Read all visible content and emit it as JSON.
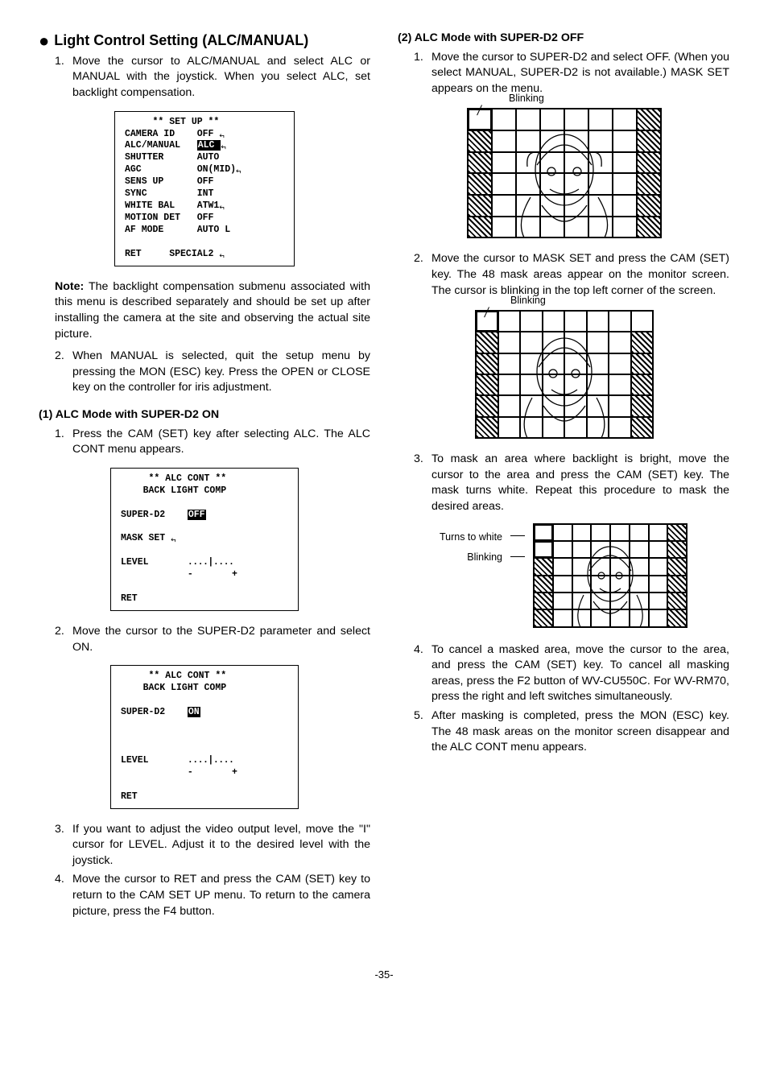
{
  "leftCol": {
    "heading": "Light Control Setting (ALC/MANUAL)",
    "step1": "Move the cursor to ALC/MANUAL and select ALC or MANUAL with the joystick. When you select ALC, set backlight compensation.",
    "osd1": {
      "title": "** SET UP **",
      "rows": [
        [
          "CAMERA ID",
          "OFF ",
          true
        ],
        [
          "ALC/MANUAL",
          "ALC ",
          true,
          true
        ],
        [
          "SHUTTER",
          "AUTO",
          false
        ],
        [
          "AGC",
          "ON(MID)",
          true
        ],
        [
          "SENS UP",
          "OFF",
          false
        ],
        [
          "SYNC",
          "INT",
          false
        ],
        [
          "WHITE BAL",
          "ATW1",
          true
        ],
        [
          "MOTION DET",
          "OFF",
          false
        ],
        [
          "AF MODE",
          "AUTO L",
          false
        ]
      ],
      "footer": [
        "RET",
        "SPECIAL2 "
      ]
    },
    "noteLabel": "Note:",
    "noteText": "The backlight compensation submenu associated with this menu is described separately and should be set up after installing the camera at the site and observing the actual site picture.",
    "step2": "When MANUAL is selected, quit the setup menu by pressing the MON (ESC) key. Press the OPEN or CLOSE key on the controller for iris adjustment.",
    "sub1": "(1) ALC Mode with SUPER-D2 ON",
    "sub1_step1": "Press the CAM (SET) key after selecting ALC. The ALC CONT menu appears.",
    "osd2": {
      "title1": "** ALC CONT **",
      "title2": "BACK LIGHT COMP",
      "sd2Label": "SUPER-D2",
      "sd2Val": "OFF",
      "sd2Hl": true,
      "mask": "MASK SET ",
      "maskArrow": true,
      "levelLabel": "LEVEL",
      "levelSlider": "....|....",
      "levelMinus": "-",
      "levelPlus": "+",
      "ret": "RET"
    },
    "sub1_step2": "Move the cursor to the SUPER-D2 parameter and select ON.",
    "osd3": {
      "title1": "** ALC CONT **",
      "title2": "BACK LIGHT COMP",
      "sd2Label": "SUPER-D2",
      "sd2Val": "ON",
      "sd2Hl": true,
      "levelLabel": "LEVEL",
      "levelSlider": "....|....",
      "levelMinus": "-",
      "levelPlus": "+",
      "ret": "RET"
    },
    "sub1_step3": "If you want to adjust the video output level, move the \"I\" cursor for LEVEL. Adjust it to the desired level with the joystick.",
    "sub1_step4": "Move the cursor to RET and press the CAM (SET) key to return to the CAM SET UP menu. To return to the camera picture, press the F4 button."
  },
  "rightCol": {
    "sub2": "(2) ALC Mode with SUPER-D2 OFF",
    "sub2_step1": "Move the cursor to SUPER-D2 and select OFF. (When you select MANUAL, SUPER-D2 is not available.) MASK SET appears on the menu.",
    "blinkLabel1": "Blinking",
    "sub2_step2": "Move the cursor to MASK SET and press the CAM (SET) key. The 48 mask areas appear on the monitor screen. The cursor is blinking in the top left corner of the screen.",
    "blinkLabel2": "Blinking",
    "sub2_step3": "To mask an area where backlight is bright, move the cursor to the area and press the CAM (SET) key. The mask turns white. Repeat this procedure to mask the desired areas.",
    "fig3Label1": "Turns to white",
    "fig3Label2": "Blinking",
    "sub2_step4": "To cancel a masked area, move the cursor to the area, and press the CAM (SET) key. To cancel all masking areas, press the F2 button of WV-CU550C. For WV-RM70, press the right and left switches simultaneously.",
    "sub2_step5": "After masking is completed, press the MON (ESC) key. The 48 mask areas on the monitor screen disappear and the ALC CONT menu appears."
  },
  "pageNumber": "-35-"
}
